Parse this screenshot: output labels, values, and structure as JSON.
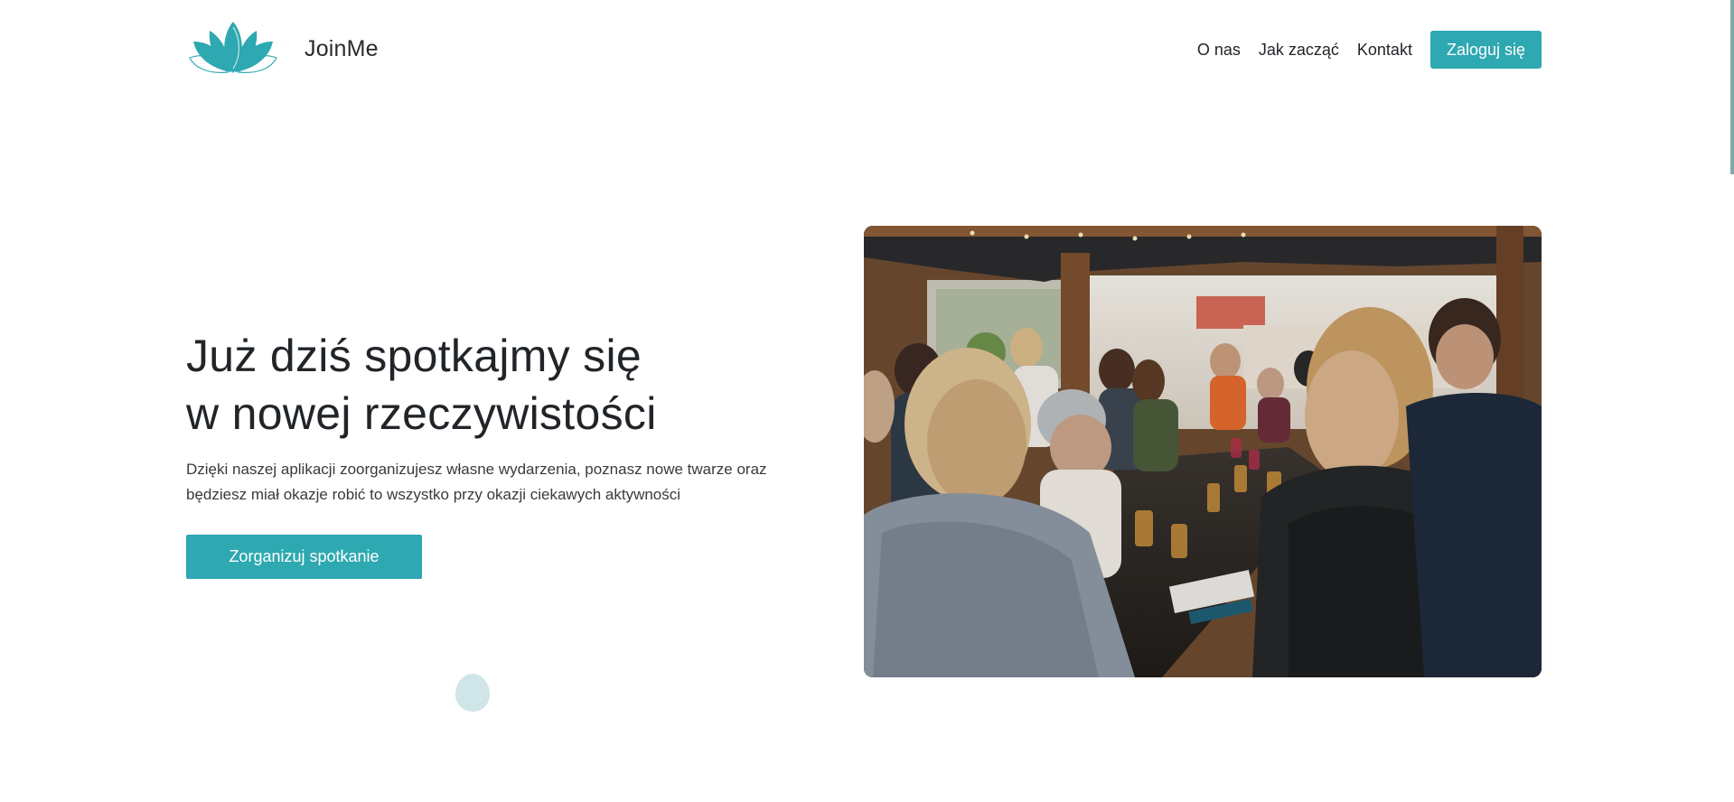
{
  "header": {
    "brand": "JoinMe",
    "logo_icon": "lotus-icon",
    "nav": [
      {
        "label": "O nas"
      },
      {
        "label": "Jak zacząć"
      },
      {
        "label": "Kontakt"
      }
    ],
    "login_label": "Zaloguj się"
  },
  "hero": {
    "title_line1": "Już dziś spotkajmy się",
    "title_line2": "w nowej rzeczywistości",
    "text_line1": "Dzięki naszej aplikacji zoorganizujesz własne wydarzenia, poznasz nowe twarze oraz",
    "text_line2": "będziesz miał okazje robić to wszystko przy okazji ciekawych aktywności",
    "cta_label": "Zorganizuj spotkanie"
  },
  "colors": {
    "accent": "#2ea8b1",
    "blob": "#cfe5e7",
    "text": "#212529"
  }
}
